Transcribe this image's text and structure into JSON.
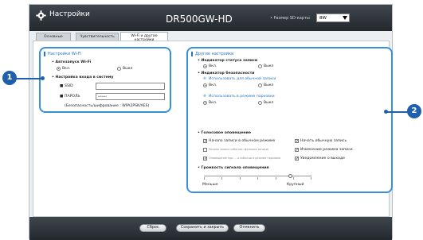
{
  "window": {
    "title": "Настройки",
    "model": "DR500GW-HD",
    "sd_label": "• Размер SD-карты",
    "sd_value": "8W"
  },
  "tabs": [
    {
      "label": "Основные"
    },
    {
      "label": "Чувствительность"
    },
    {
      "label": "Wi-Fi и другие настройки"
    }
  ],
  "wifi": {
    "section_title": "Настройки Wi-Fi",
    "auto_label": "• Автозапуск Wi-Fi",
    "on": "Вкл.",
    "off": "Выкл",
    "login_label": "• Настройка входа в систему",
    "ssid_label": "SSID",
    "ssid_value": "",
    "password_label": "ПАРОЛЬ",
    "password_value": "*******",
    "security_note": "(Безопасность/шифрование : WPA2PSK/AES)"
  },
  "other": {
    "section_title": "Другие настройки",
    "status_label": "• Индикатор статуса записи",
    "security_label": "• Индикатор безопасности",
    "normal_rec_label": "Использовать для обычной записи",
    "parking_rec_label": "Использовать в режиме парковки",
    "on": "Вкл.",
    "off": "Выкл",
    "voice_label": "• Голосовое оповещение",
    "voice_items": [
      {
        "label": "Начало записи в обычном режиме",
        "checked": true
      },
      {
        "label": "Начать обычную запись",
        "checked": true
      },
      {
        "label": "Начало записи события (функция записи)",
        "checked": false
      },
      {
        "label": "Изменение режима записи",
        "checked": true
      },
      {
        "label": "Оповещение при ... о событии в режиме парковки",
        "checked": true
      },
      {
        "label": "Уведомление о выходе",
        "checked": true
      }
    ],
    "volume_label": "• Громкость сигнала оповещения",
    "volume_min": "Меньше",
    "volume_max": "Крупный",
    "volume_level": 0.8
  },
  "footer": {
    "reset": "Сброс",
    "save_close": "Сохранить и закрыть",
    "cancel": "Отменить"
  },
  "callouts": [
    "1",
    "2"
  ],
  "colors": {
    "accent": "#3a8fdc",
    "callout": "#1f5fad",
    "titlebar": "#2e3439"
  }
}
